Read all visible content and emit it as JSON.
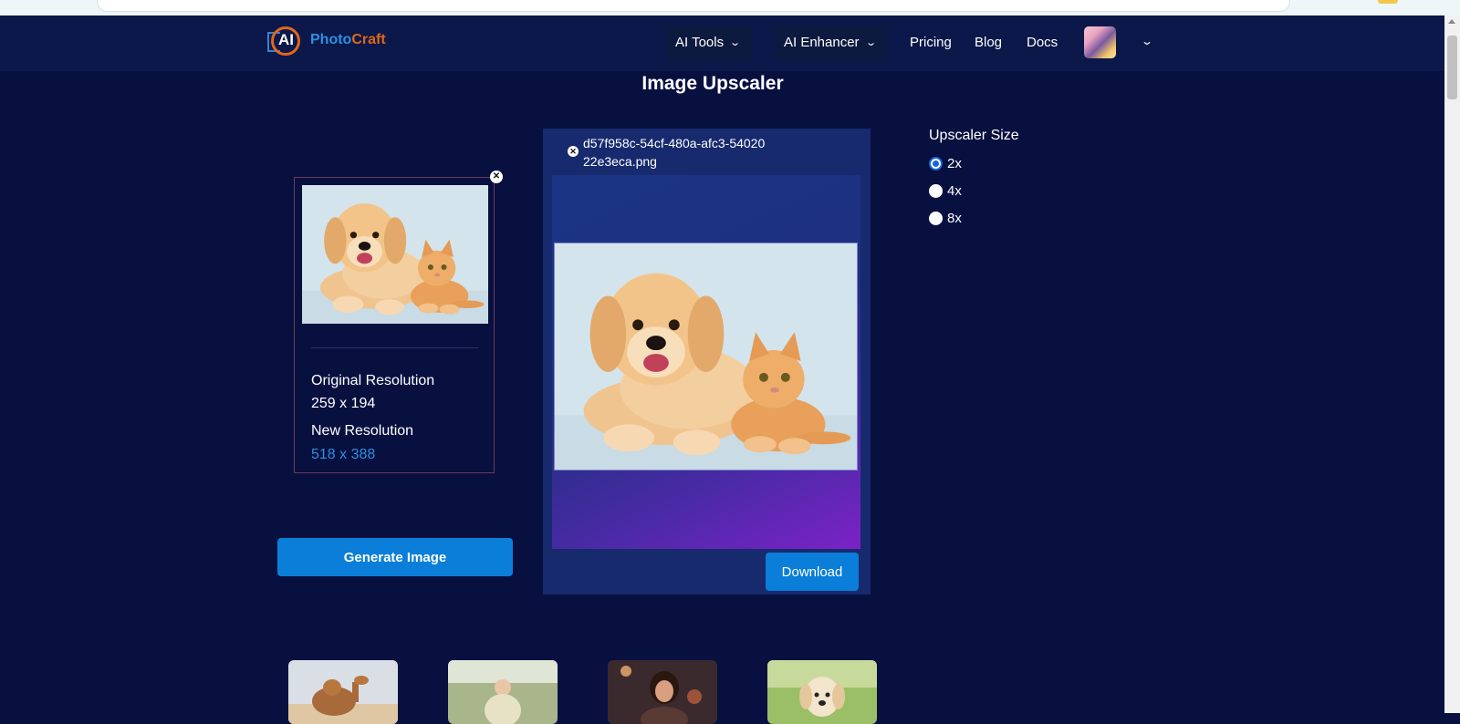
{
  "nav": {
    "logo_ai": "AI",
    "logo_photo": "Photo",
    "logo_craft": "Craft",
    "ai_tools_label": "AI Tools",
    "ai_enhancer_label": "AI Enhancer",
    "pricing_label": "Pricing",
    "blog_label": "Blog",
    "docs_label": "Docs"
  },
  "page": {
    "title": "Image Upscaler"
  },
  "original": {
    "original_resolution_label": "Original Resolution",
    "original_resolution_value": "259 x 194",
    "new_resolution_label": "New Resolution",
    "new_resolution_value": "518 x 388"
  },
  "actions": {
    "generate_label": "Generate Image",
    "download_label": "Download"
  },
  "result": {
    "file_name": "d57f958c-54cf-480a-afc3-5402022e3eca.png"
  },
  "upscaler": {
    "title": "Upscaler Size",
    "options": [
      {
        "label": "2x",
        "selected": true
      },
      {
        "label": "4x",
        "selected": false
      },
      {
        "label": "8x",
        "selected": false
      }
    ]
  },
  "icons": {
    "close": "close-icon",
    "chevron": "chevron-down-icon"
  },
  "colors": {
    "page_bg": "#081040",
    "navbar_bg": "#0b1849",
    "button_blue": "#0a7ed8",
    "link_blue": "#2d8fe0",
    "logo_orange": "#e2661a"
  }
}
